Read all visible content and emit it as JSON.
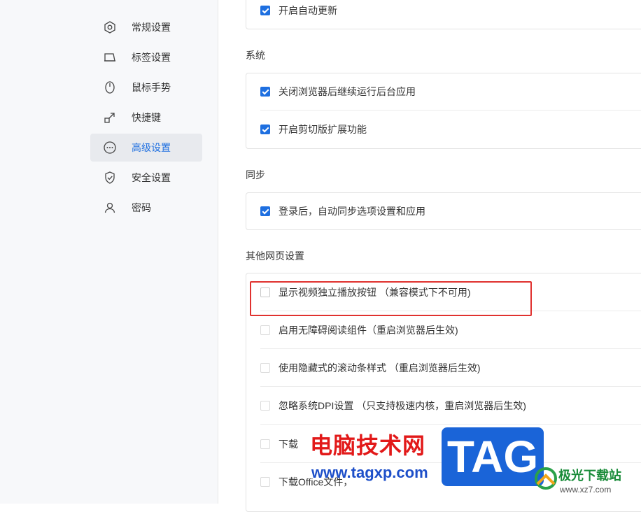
{
  "sidebar": {
    "items": [
      {
        "label": "常规设置",
        "icon": "hexagon-gear-icon",
        "active": false
      },
      {
        "label": "标签设置",
        "icon": "tab-icon",
        "active": false
      },
      {
        "label": "鼠标手势",
        "icon": "mouse-icon",
        "active": false
      },
      {
        "label": "快捷键",
        "icon": "shortcut-arrow-icon",
        "active": false
      },
      {
        "label": "高级设置",
        "icon": "more-circle-icon",
        "active": true
      },
      {
        "label": "安全设置",
        "icon": "shield-check-icon",
        "active": false
      },
      {
        "label": "密码",
        "icon": "user-icon",
        "active": false
      }
    ]
  },
  "update": {
    "auto_update": {
      "label": "开启自动更新",
      "checked": true
    }
  },
  "system": {
    "title": "系统",
    "items": [
      {
        "label": "关闭浏览器后继续运行后台应用",
        "checked": true
      },
      {
        "label": "开启剪切版扩展功能",
        "checked": true
      }
    ]
  },
  "sync": {
    "title": "同步",
    "items": [
      {
        "label": "登录后，自动同步选项设置和应用",
        "checked": true
      }
    ]
  },
  "other": {
    "title": "其他网页设置",
    "items": [
      {
        "label": "显示视频独立播放按钮 （兼容模式下不可用)",
        "checked": false
      },
      {
        "label": "启用无障碍阅读组件（重启浏览器后生效)",
        "checked": false
      },
      {
        "label": "使用隐藏式的滚动条样式 （重启浏览器后生效)",
        "checked": false
      },
      {
        "label": "忽略系统DPI设置 （只支持极速内核，重启浏览器后生效)",
        "checked": false
      },
      {
        "label": "下载",
        "checked": false
      },
      {
        "label": "下载Office文件，",
        "checked": false
      }
    ]
  },
  "watermark": {
    "site_name": "电脑技术网",
    "site_url": "www.tagxp.com",
    "tag_logo": "TAG",
    "xz_name": "极光下载站",
    "xz_url": "www.xz7.com"
  },
  "colors": {
    "accent": "#1e6fe0",
    "highlight_box": "#e0322f",
    "sidebar_active_bg": "#e8eaee"
  }
}
